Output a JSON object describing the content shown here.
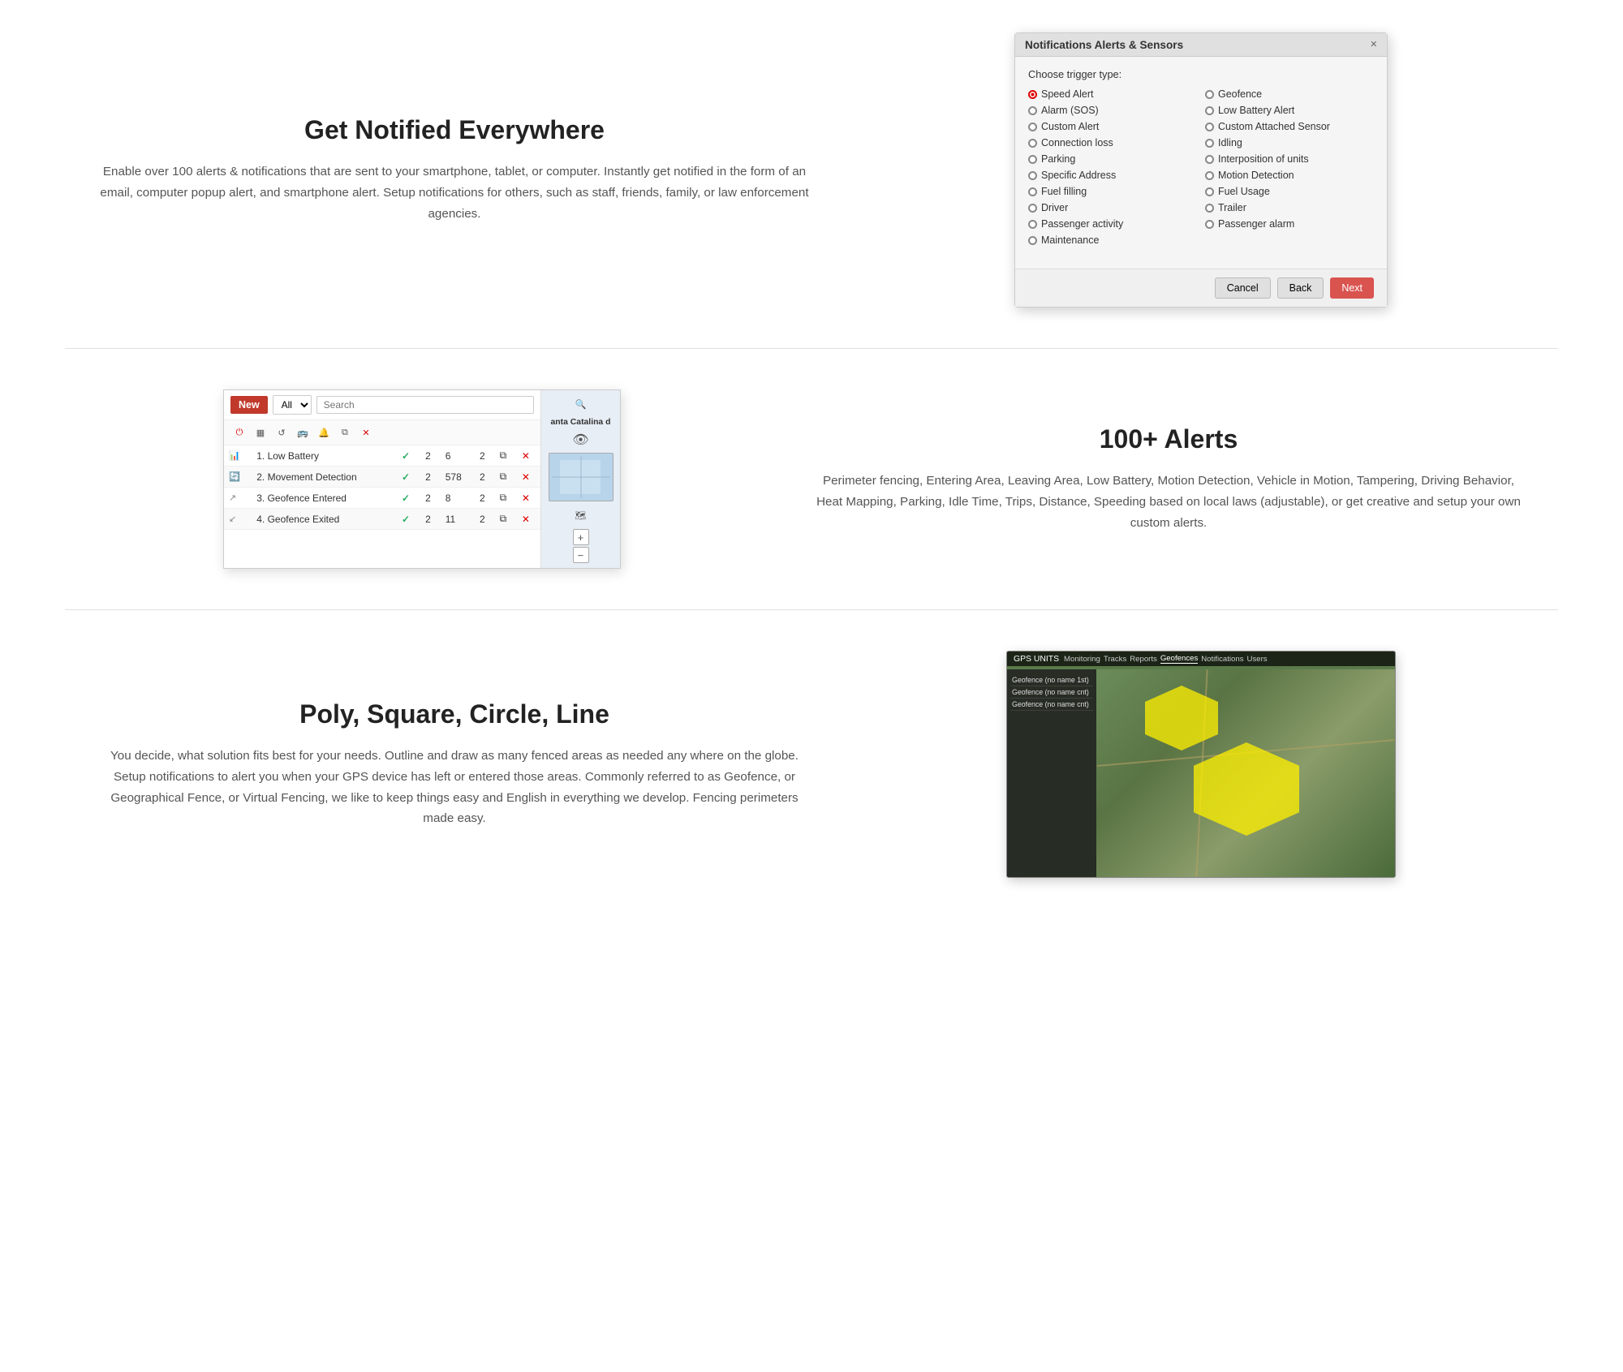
{
  "sections": {
    "notified": {
      "title": "Get Notified Everywhere",
      "body": "Enable over 100 alerts & notifications that are sent to your smartphone, tablet, or computer. Instantly get notified in the form of an email, computer popup alert, and smartphone alert. Setup notifications for others, such as staff, friends, family, or law enforcement agencies."
    },
    "alerts": {
      "title": "100+ Alerts",
      "body": "Perimeter fencing, Entering Area, Leaving Area, Low Battery, Motion Detection, Vehicle in Motion, Tampering, Driving Behavior, Heat Mapping, Parking, Idle Time, Trips, Distance, Speeding based on local laws (adjustable), or get creative and setup your own custom alerts."
    },
    "geo": {
      "title": "Poly, Square, Circle, Line",
      "body": "You decide, what solution fits best for your needs. Outline and draw as many fenced areas as needed any where on the globe. Setup notifications to alert you when your GPS device has left or entered those areas. Commonly referred to as Geofence, or Geographical Fence, or Virtual Fencing, we like to keep things easy and English in everything we develop. Fencing perimeters made easy."
    }
  },
  "dialog": {
    "title": "Notifications Alerts & Sensors",
    "subtitle": "Choose trigger type:",
    "close_label": "×",
    "options_left": [
      {
        "label": "Speed Alert",
        "selected": true
      },
      {
        "label": "Alarm (SOS)",
        "selected": false
      },
      {
        "label": "Custom Alert",
        "selected": false
      },
      {
        "label": "Connection loss",
        "selected": false
      },
      {
        "label": "Parking",
        "selected": false
      },
      {
        "label": "Specific Address",
        "selected": false
      },
      {
        "label": "Fuel filling",
        "selected": false
      },
      {
        "label": "Driver",
        "selected": false
      },
      {
        "label": "Passenger activity",
        "selected": false
      },
      {
        "label": "Maintenance",
        "selected": false
      }
    ],
    "options_right": [
      {
        "label": "Geofence",
        "selected": false
      },
      {
        "label": "Low Battery Alert",
        "selected": false
      },
      {
        "label": "Custom Attached Sensor",
        "selected": false
      },
      {
        "label": "Idling",
        "selected": false
      },
      {
        "label": "Interposition of units",
        "selected": false
      },
      {
        "label": "Motion Detection",
        "selected": false
      },
      {
        "label": "Fuel Usage",
        "selected": false
      },
      {
        "label": "Trailer",
        "selected": false
      },
      {
        "label": "Passenger alarm",
        "selected": false
      }
    ],
    "btn_cancel": "Cancel",
    "btn_back": "Back",
    "btn_next": "Next"
  },
  "alerts_table": {
    "new_label": "New",
    "all_label": "All",
    "search_placeholder": "Search",
    "rows": [
      {
        "icon": "bar-icon",
        "name": "1. Low Battery",
        "check": true,
        "count1": 2,
        "count2": 6,
        "count3": 2
      },
      {
        "icon": "circle-icon",
        "name": "2. Movement Detection",
        "check": true,
        "count1": 2,
        "count2": 578,
        "count3": 2
      },
      {
        "icon": "arrow-icon",
        "name": "3. Geofence Entered",
        "check": true,
        "count1": 2,
        "count2": 8,
        "count3": 2
      },
      {
        "icon": "arrow-icon",
        "name": "4. Geofence Exited",
        "check": true,
        "count1": 2,
        "count2": 11,
        "count3": 2
      }
    ],
    "map_label": "anta Catalina d"
  },
  "geo_mock": {
    "app_name": "GPS UNITS",
    "tabs": [
      "Monitoring",
      "Tracks",
      "Reports",
      "Geofences",
      "Notifications",
      "Users"
    ],
    "sidebar_rows": [
      "Geofence (no name 1st)",
      "Geofence (no name cnt)",
      "Geofence (no name cnt)"
    ]
  }
}
